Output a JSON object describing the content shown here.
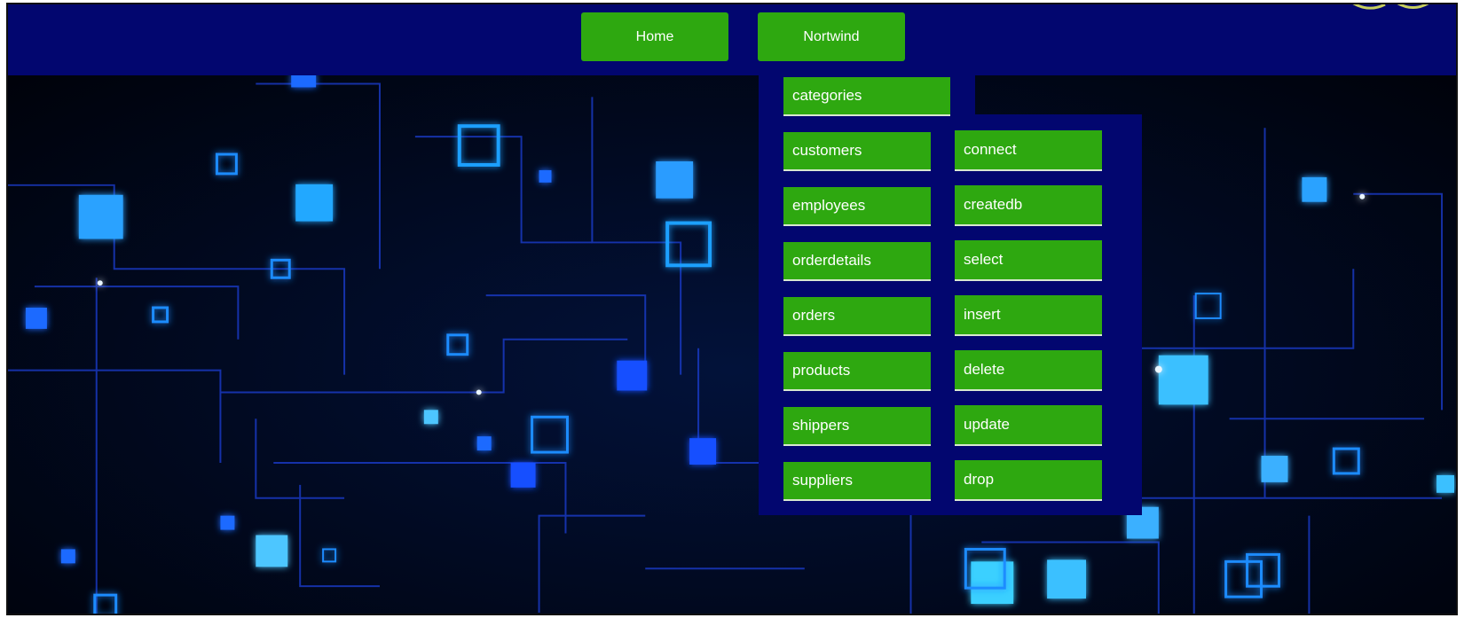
{
  "colors": {
    "navbar": "#02066f",
    "button": "#2ea810",
    "button_text": "#ffffff",
    "background": "#00030f",
    "accent_blue": "#1e8cff"
  },
  "navbar": {
    "items": [
      {
        "label": "Home"
      },
      {
        "label": "Nortwind"
      }
    ]
  },
  "dropdown": {
    "tables": [
      {
        "label": "categories"
      },
      {
        "label": "customers"
      },
      {
        "label": "employees"
      },
      {
        "label": "orderdetails"
      },
      {
        "label": "orders"
      },
      {
        "label": "products"
      },
      {
        "label": "shippers"
      },
      {
        "label": "suppliers"
      }
    ],
    "actions": [
      {
        "label": "connect"
      },
      {
        "label": "createdb"
      },
      {
        "label": "select"
      },
      {
        "label": "insert"
      },
      {
        "label": "delete"
      },
      {
        "label": "update"
      },
      {
        "label": "drop"
      }
    ]
  }
}
